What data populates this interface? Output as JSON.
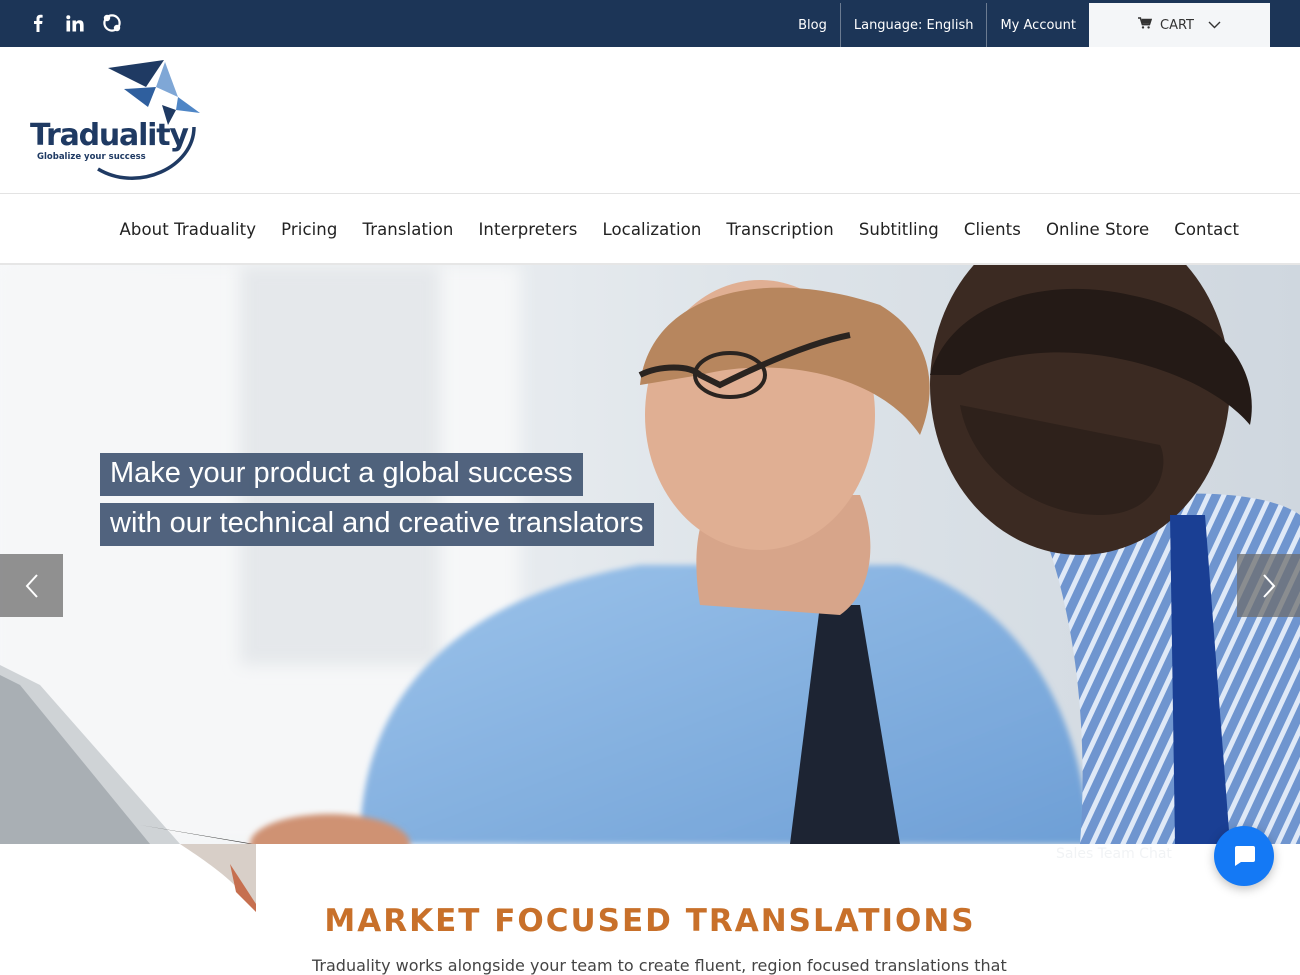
{
  "colors": {
    "topbar": "#1c3557",
    "accent_orange": "#c8702a",
    "chat_blue": "#1479f5",
    "headline_bg": "#3a4e6c"
  },
  "social": [
    {
      "name": "facebook-icon",
      "glyph": "f"
    },
    {
      "name": "linkedin-icon",
      "glyph": "in"
    },
    {
      "name": "skype-icon",
      "glyph": "S"
    }
  ],
  "top_links": {
    "blog": "Blog",
    "language": "Language: English",
    "account": "My Account",
    "cart": "CART"
  },
  "logo": {
    "brand": "Traduality",
    "tagline": "Globalize your success"
  },
  "nav": {
    "items": [
      "About Traduality",
      "Pricing",
      "Translation",
      "Interpreters",
      "Localization",
      "Transcription",
      "Subtitling",
      "Clients",
      "Online Store",
      "Contact"
    ]
  },
  "hero": {
    "line1": "Make your product a global success",
    "line2": "with our technical and creative translators"
  },
  "section": {
    "title": "MARKET FOCUSED TRANSLATIONS",
    "text": "Traduality works alongside your team to create fluent, region focused translations that"
  },
  "chat": {
    "label": "Sales Team Chat"
  }
}
